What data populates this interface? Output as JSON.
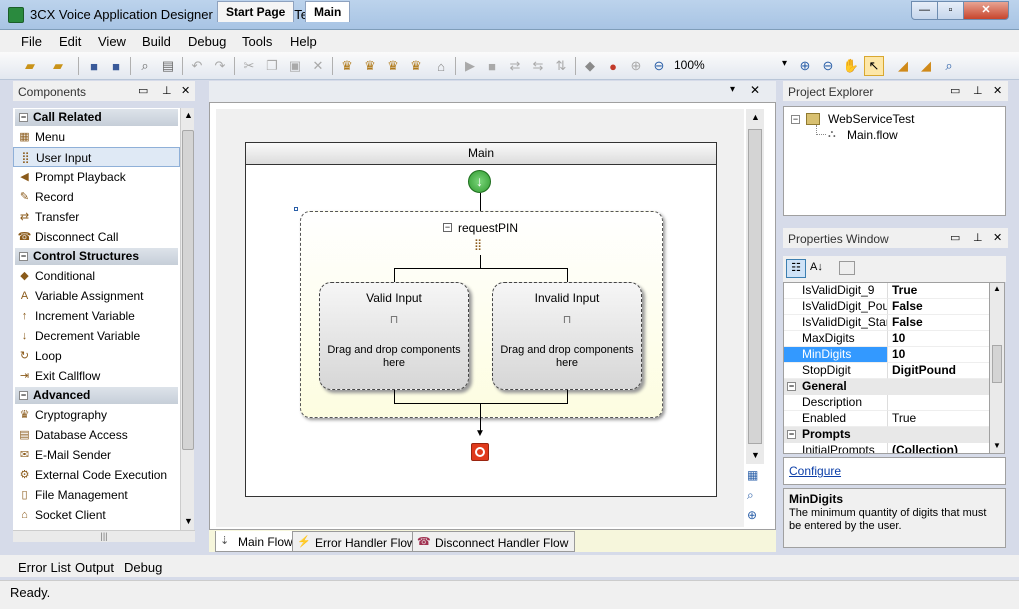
{
  "window": {
    "title": "3CX Voice Application Designer - WebServiceTest",
    "min": "—",
    "max": "▫",
    "close": "✕"
  },
  "menu": [
    "File",
    "Edit",
    "View",
    "Build",
    "Debug",
    "Tools",
    "Help"
  ],
  "toolbar": {
    "zoom": "100%",
    "icons": [
      "open-folder-icon",
      "open-menu-icon",
      "save-icon",
      "save-all-icon",
      "preview-icon",
      "print-icon",
      "undo-icon",
      "redo-icon",
      "cut-icon",
      "copy-icon",
      "paste-icon",
      "delete-icon",
      "component-1-icon",
      "component-2-icon",
      "component-3-icon",
      "component-4-icon",
      "run-icon",
      "stop-icon",
      "step-icon",
      "step-over-icon",
      "step-out-icon",
      "build-icon",
      "record-icon",
      "zoom-plus-icon",
      "zoom-minus-icon",
      "zoom-in-icon",
      "zoom-out-icon",
      "pan-icon",
      "pointer-icon",
      "tool-1-icon",
      "tool-2-icon",
      "find-icon"
    ]
  },
  "components_panel": {
    "title": "Components",
    "categories": [
      {
        "label": "Call Related",
        "items": [
          {
            "label": "Menu",
            "icon": "menu-icon"
          },
          {
            "label": "User Input",
            "icon": "user-input-icon",
            "selected": true
          },
          {
            "label": "Prompt Playback",
            "icon": "speaker-icon"
          },
          {
            "label": "Record",
            "icon": "record-icon"
          },
          {
            "label": "Transfer",
            "icon": "transfer-icon"
          },
          {
            "label": "Disconnect Call",
            "icon": "disconnect-icon"
          }
        ]
      },
      {
        "label": "Control Structures",
        "items": [
          {
            "label": "Conditional",
            "icon": "conditional-icon"
          },
          {
            "label": "Variable Assignment",
            "icon": "assign-icon"
          },
          {
            "label": "Increment Variable",
            "icon": "increment-icon"
          },
          {
            "label": "Decrement Variable",
            "icon": "decrement-icon"
          },
          {
            "label": "Loop",
            "icon": "loop-icon"
          },
          {
            "label": "Exit Callflow",
            "icon": "exit-icon"
          }
        ]
      },
      {
        "label": "Advanced",
        "items": [
          {
            "label": "Cryptography",
            "icon": "crypto-icon"
          },
          {
            "label": "Database Access",
            "icon": "database-icon"
          },
          {
            "label": "E-Mail Sender",
            "icon": "email-icon"
          },
          {
            "label": "External Code Execution",
            "icon": "code-icon"
          },
          {
            "label": "File Management",
            "icon": "file-icon"
          },
          {
            "label": "Socket Client",
            "icon": "socket-icon"
          }
        ]
      }
    ]
  },
  "document_tabs": [
    "Start Page",
    "Main"
  ],
  "designer": {
    "frame_title": "Main",
    "container_title": "requestPIN",
    "branches": [
      {
        "title": "Valid Input",
        "hint": "Drag and drop components here"
      },
      {
        "title": "Invalid Input",
        "hint": "Drag and drop components here"
      }
    ]
  },
  "flow_tabs": [
    "Main Flow",
    "Error Handler Flow",
    "Disconnect Handler Flow"
  ],
  "project_explorer": {
    "title": "Project Explorer",
    "project": "WebServiceTest",
    "file": "Main.flow"
  },
  "properties": {
    "title": "Properties Window",
    "rows": [
      {
        "name": "IsValidDigit_9",
        "value": "True",
        "bold": true
      },
      {
        "name": "IsValidDigit_Pound",
        "value": "False",
        "bold": true
      },
      {
        "name": "IsValidDigit_Star",
        "value": "False",
        "bold": true
      },
      {
        "name": "MaxDigits",
        "value": "10",
        "bold": true
      },
      {
        "name": "MinDigits",
        "value": "10",
        "bold": true,
        "selected": true
      },
      {
        "name": "StopDigit",
        "value": "DigitPound",
        "bold": true
      }
    ],
    "general_label": "General",
    "general_rows": [
      {
        "name": "Description",
        "value": ""
      },
      {
        "name": "Enabled",
        "value": "True"
      }
    ],
    "prompts_label": "Prompts",
    "prompts_rows": [
      {
        "name": "InitialPrompts",
        "value": "(Collection)"
      }
    ],
    "configure_link": "Configure",
    "desc_title": "MinDigits",
    "desc_text": "The minimum quantity of digits that must be entered by the user."
  },
  "bottom_tabs": [
    "Error List",
    "Output",
    "Debug"
  ],
  "status": "Ready."
}
